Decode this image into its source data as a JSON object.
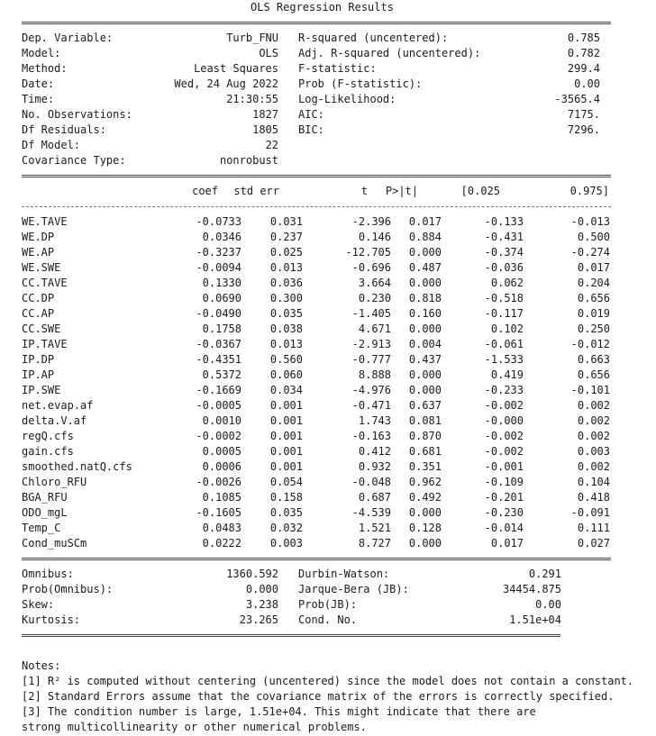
{
  "title": "OLS Regression Results",
  "summary": [
    {
      "l_label": "Dep. Variable:",
      "l_value": "Turb_FNU",
      "r_label": "R-squared (uncentered):",
      "r_value": "0.785"
    },
    {
      "l_label": "Model:",
      "l_value": "OLS",
      "r_label": "Adj. R-squared (uncentered):",
      "r_value": "0.782"
    },
    {
      "l_label": "Method:",
      "l_value": "Least Squares",
      "r_label": "F-statistic:",
      "r_value": "299.4"
    },
    {
      "l_label": "Date:",
      "l_value": "Wed, 24 Aug 2022",
      "r_label": "Prob (F-statistic):",
      "r_value": "0.00"
    },
    {
      "l_label": "Time:",
      "l_value": "21:30:55",
      "r_label": "Log-Likelihood:",
      "r_value": "-3565.4"
    },
    {
      "l_label": "No. Observations:",
      "l_value": "1827",
      "r_label": "AIC:",
      "r_value": "7175."
    },
    {
      "l_label": "Df Residuals:",
      "l_value": "1805",
      "r_label": "BIC:",
      "r_value": "7296."
    },
    {
      "l_label": "Df Model:",
      "l_value": "22",
      "r_label": "",
      "r_value": ""
    },
    {
      "l_label": "Covariance Type:",
      "l_value": "nonrobust",
      "r_label": "",
      "r_value": ""
    }
  ],
  "coef_headers": [
    "coef",
    "std err",
    "t",
    "P>|t|",
    "[0.025",
    "0.975]"
  ],
  "coef_rows": [
    [
      "WE.TAVE",
      "-0.0733",
      "0.031",
      "-2.396",
      "0.017",
      "-0.133",
      "-0.013"
    ],
    [
      "WE.DP",
      "0.0346",
      "0.237",
      "0.146",
      "0.884",
      "-0.431",
      "0.500"
    ],
    [
      "WE.AP",
      "-0.3237",
      "0.025",
      "-12.705",
      "0.000",
      "-0.374",
      "-0.274"
    ],
    [
      "WE.SWE",
      "-0.0094",
      "0.013",
      "-0.696",
      "0.487",
      "-0.036",
      "0.017"
    ],
    [
      "CC.TAVE",
      "0.1330",
      "0.036",
      "3.664",
      "0.000",
      "0.062",
      "0.204"
    ],
    [
      "CC.DP",
      "0.0690",
      "0.300",
      "0.230",
      "0.818",
      "-0.518",
      "0.656"
    ],
    [
      "CC.AP",
      "-0.0490",
      "0.035",
      "-1.405",
      "0.160",
      "-0.117",
      "0.019"
    ],
    [
      "CC.SWE",
      "0.1758",
      "0.038",
      "4.671",
      "0.000",
      "0.102",
      "0.250"
    ],
    [
      "IP.TAVE",
      "-0.0367",
      "0.013",
      "-2.913",
      "0.004",
      "-0.061",
      "-0.012"
    ],
    [
      "IP.DP",
      "-0.4351",
      "0.560",
      "-0.777",
      "0.437",
      "-1.533",
      "0.663"
    ],
    [
      "IP.AP",
      "0.5372",
      "0.060",
      "8.888",
      "0.000",
      "0.419",
      "0.656"
    ],
    [
      "IP.SWE",
      "-0.1669",
      "0.034",
      "-4.976",
      "0.000",
      "-0.233",
      "-0.101"
    ],
    [
      "net.evap.af",
      "-0.0005",
      "0.001",
      "-0.471",
      "0.637",
      "-0.002",
      "0.002"
    ],
    [
      "delta.V.af",
      "0.0010",
      "0.001",
      "1.743",
      "0.081",
      "-0.000",
      "0.002"
    ],
    [
      "regQ.cfs",
      "-0.0002",
      "0.001",
      "-0.163",
      "0.870",
      "-0.002",
      "0.002"
    ],
    [
      "gain.cfs",
      "0.0005",
      "0.001",
      "0.412",
      "0.681",
      "-0.002",
      "0.003"
    ],
    [
      "smoothed.natQ.cfs",
      "0.0006",
      "0.001",
      "0.932",
      "0.351",
      "-0.001",
      "0.002"
    ],
    [
      "Chloro_RFU",
      "-0.0026",
      "0.054",
      "-0.048",
      "0.962",
      "-0.109",
      "0.104"
    ],
    [
      "BGA_RFU",
      "0.1085",
      "0.158",
      "0.687",
      "0.492",
      "-0.201",
      "0.418"
    ],
    [
      "ODO_mgL",
      "-0.1605",
      "0.035",
      "-4.539",
      "0.000",
      "-0.230",
      "-0.091"
    ],
    [
      "Temp_C",
      "0.0483",
      "0.032",
      "1.521",
      "0.128",
      "-0.014",
      "0.111"
    ],
    [
      "Cond_muSCm",
      "0.0222",
      "0.003",
      "8.727",
      "0.000",
      "0.017",
      "0.027"
    ]
  ],
  "diagnostics": [
    {
      "l_label": "Omnibus:",
      "l_value": "1360.592",
      "r_label": "Durbin-Watson:",
      "r_value": "0.291"
    },
    {
      "l_label": "Prob(Omnibus):",
      "l_value": "0.000",
      "r_label": "Jarque-Bera (JB):",
      "r_value": "34454.875"
    },
    {
      "l_label": "Skew:",
      "l_value": "3.238",
      "r_label": "Prob(JB):",
      "r_value": "0.00"
    },
    {
      "l_label": "Kurtosis:",
      "l_value": "23.265",
      "r_label": "Cond. No.",
      "r_value": "1.51e+04"
    }
  ],
  "notes_label": "Notes:",
  "notes": [
    "[1] R² is computed without centering (uncentered) since the model does not contain a constant.",
    "[2] Standard Errors assume that the covariance matrix of the errors is correctly specified.",
    "[3] The condition number is large, 1.51e+04. This might indicate that there are",
    "strong multicollinearity or other numerical problems."
  ]
}
